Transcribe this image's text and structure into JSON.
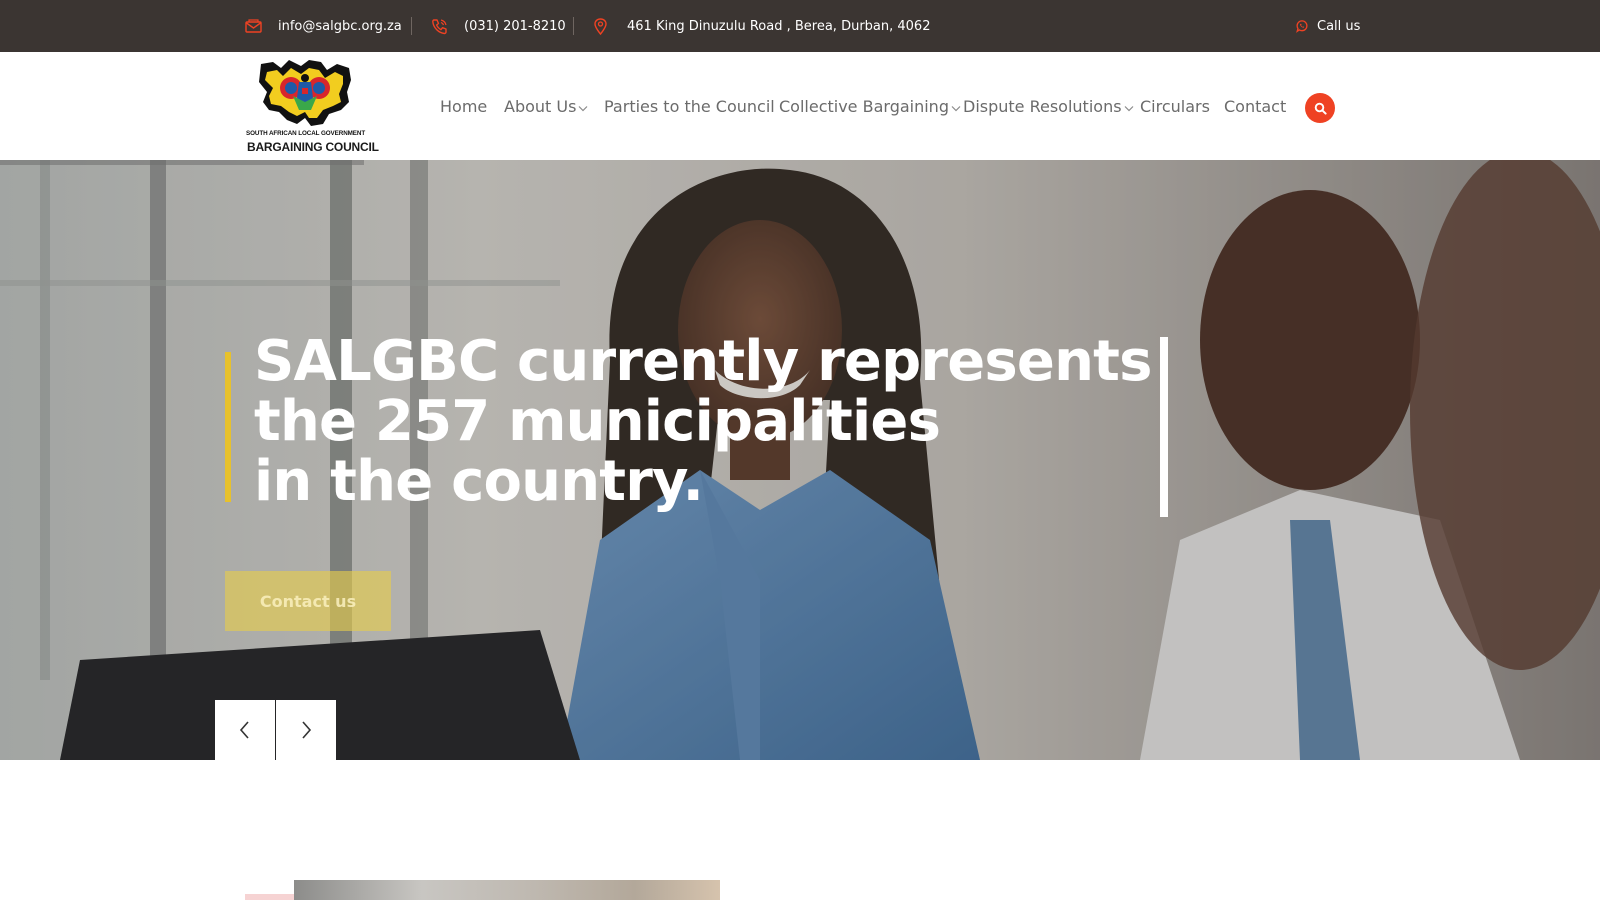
{
  "topbar": {
    "email": "info@salgbc.org.za",
    "phone": "(031) 201-8210",
    "address": "461 King Dinuzulu Road , Berea, Durban, 4062",
    "call_label": "Call us",
    "icons": [
      "envelope-icon",
      "phone-icon",
      "location-pin-icon",
      "whatsapp-icon"
    ],
    "icon_color": "#ef4223",
    "background": "#3b3532"
  },
  "logo": {
    "subtitle": "SOUTH AFRICAN LOCAL GOVERNMENT",
    "name": "BARGAINING COUNCIL"
  },
  "nav": {
    "items": [
      {
        "label": "Home",
        "dropdown": false
      },
      {
        "label": "About Us",
        "dropdown": true
      },
      {
        "label": "Parties to the Council",
        "dropdown": false
      },
      {
        "label": "Collective Bargaining",
        "dropdown": true
      },
      {
        "label": "Dispute Resolutions",
        "dropdown": true
      },
      {
        "label": "Circulars",
        "dropdown": false
      },
      {
        "label": "Contact",
        "dropdown": false
      }
    ],
    "search_icon": "search-icon",
    "search_color": "#ef4223"
  },
  "hero": {
    "title_lines": [
      "SALGBC currently represents",
      "the 257 municipalities",
      "in the country."
    ],
    "cta_label": "Contact us",
    "prev_icon": "chevron-left-icon",
    "next_icon": "chevron-right-icon",
    "accent_color": "#e7c12c"
  }
}
